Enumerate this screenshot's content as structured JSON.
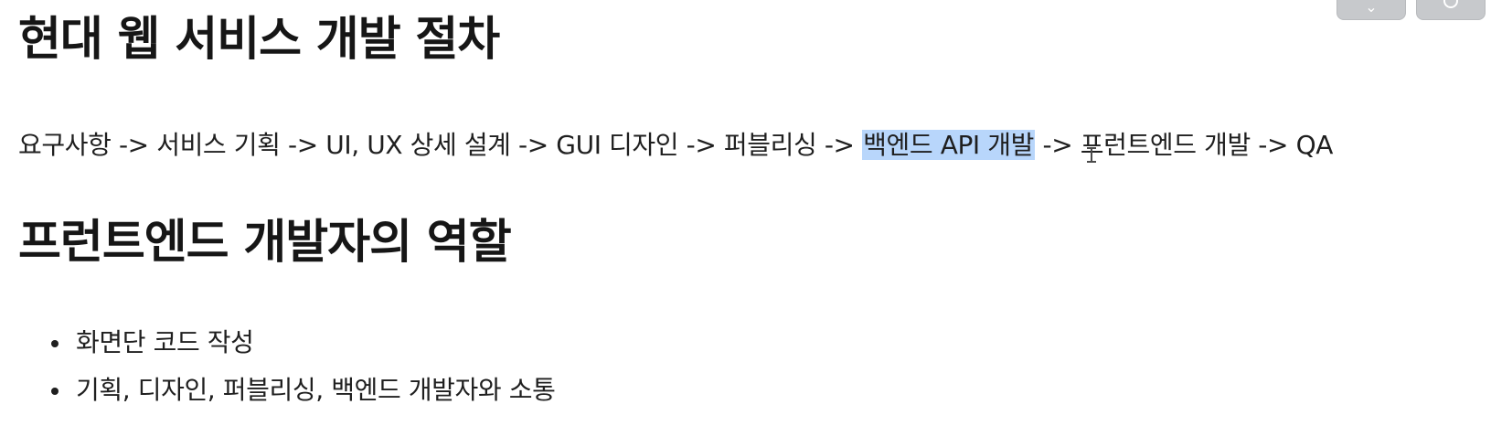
{
  "page": {
    "title": "현대 웹 서비스 개발 절차",
    "process": {
      "before_selection": "요구사항 -> 서비스 기획 -> UI, UX 상세 설계 -> GUI 디자인 -> 퍼블리싱 -> ",
      "selected": "백엔드 API 개발",
      "after_selection": " -> 프런트엔드 개발 -> QA"
    },
    "section_title": "프런트엔드 개발자의 역할",
    "roles": [
      "화면단 코드 작성",
      "기획, 디자인, 퍼블리싱, 백엔드 개발자와 소통"
    ]
  },
  "toolbar": {
    "buttons": [
      {
        "icon": "share-icon"
      },
      {
        "icon": "circle-icon"
      }
    ]
  },
  "colors": {
    "text": "#1f1f1f",
    "selection": "#b8d6fb",
    "top_button": "#c7c9cc"
  }
}
